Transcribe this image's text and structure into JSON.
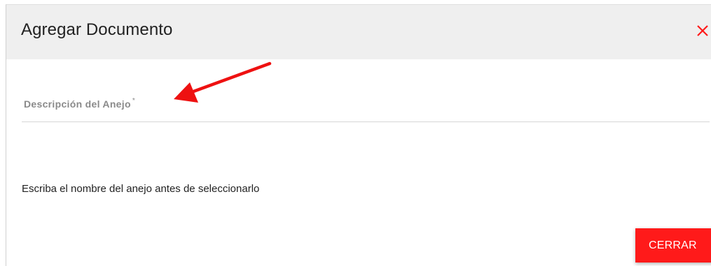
{
  "dialog": {
    "title": "Agregar Documento",
    "close_icon": "close-icon",
    "accent_color": "#ff1a1a"
  },
  "form": {
    "description_field": {
      "label": "Descripción del Anejo",
      "required_marker": "*",
      "value": ""
    },
    "help_text": "Escriba el nombre del anejo antes de seleccionarlo"
  },
  "annotation": {
    "arrow_icon": "red-arrow-icon"
  },
  "footer": {
    "close_button_label": "CERRAR"
  }
}
